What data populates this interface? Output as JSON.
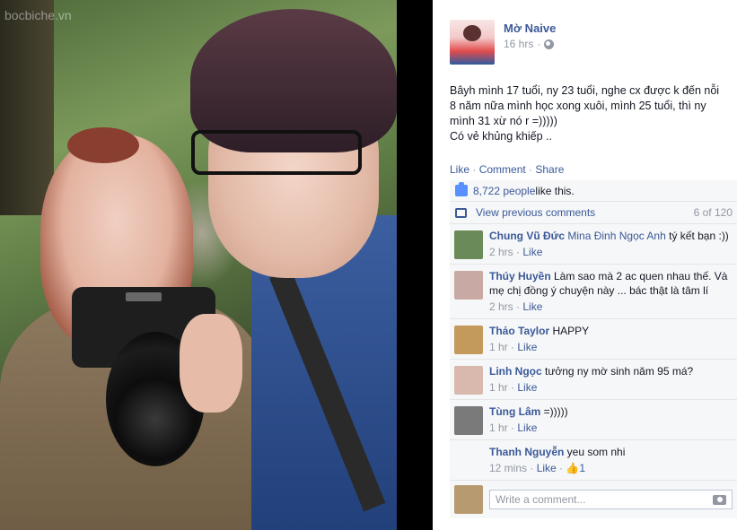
{
  "photo": {
    "watermark": "bocbiche.vn"
  },
  "post": {
    "author": "Mờ Naive",
    "time": "16 hrs",
    "privacy_icon": "globe-icon",
    "text_line1": "Bâyh mình 17 tuổi, ny 23 tuổi, nghe cx được k đến nỗi 8 năm nữa mình học xong xuôi, mình 25 tuổi, thì ny mình 31 xừ nó r =)))))",
    "text_line2": "Có vẻ khủng khiếp ..",
    "actions": {
      "like": "Like",
      "comment": "Comment",
      "share": "Share",
      "sep": " · "
    }
  },
  "ufi": {
    "likes_count": "8,722 people",
    "likes_suffix": " like this.",
    "view_previous": "View previous comments",
    "pager": "6 of 120",
    "comments": [
      {
        "author": "Chung Vũ Đức",
        "tag": "Mina Đinh Ngọc Anh",
        "text": " tý kết bạn :))",
        "time": "2 hrs",
        "like": "Like",
        "avatar_color": "#6b8a5a"
      },
      {
        "author": "Thúy Huyền",
        "tag": "",
        "text": " Làm sao mà 2 ac quen nhau thế. Và mẹ chị đồng ý chuyện này ... bác thật là tâm lí",
        "time": "2 hrs",
        "like": "Like",
        "avatar_color": "#c9a9a4"
      },
      {
        "author": "Thảo Taylor",
        "tag": "",
        "text": " HAPPY",
        "time": "1 hr",
        "like": "Like",
        "avatar_color": "#c49a5c"
      },
      {
        "author": "Linh Ngọc",
        "tag": "",
        "text": " tưởng ny mờ sinh năm 95 má?",
        "time": "1 hr",
        "like": "Like",
        "avatar_color": "#d9b8ae"
      },
      {
        "author": "Tùng Lâm",
        "tag": "",
        "text": " =)))))",
        "time": "1 hr",
        "like": "Like",
        "avatar_color": "#7a7a7a"
      },
      {
        "author": "Thanh Nguyễn",
        "tag": "",
        "text": " yeu som nhi",
        "time": "12 mins",
        "like": "Like",
        "like_count": "1",
        "avatar_color": "#f6f7f8"
      }
    ],
    "write_placeholder": "Write a comment...",
    "write_avatar_color": "#b89a70"
  }
}
